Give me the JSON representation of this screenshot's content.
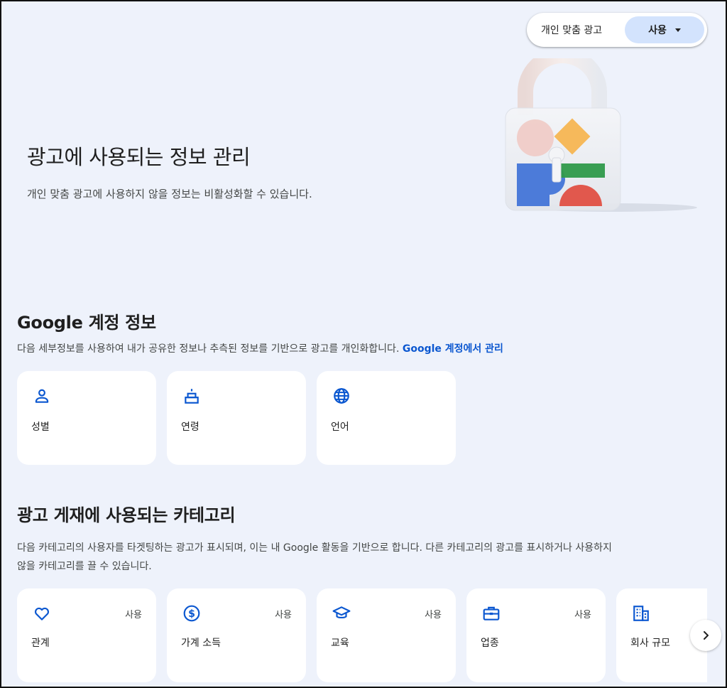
{
  "ad_personalization": {
    "label": "개인 맞춤 광고",
    "value": "사용"
  },
  "hero": {
    "title": "광고에 사용되는 정보 관리",
    "subtitle": "개인 맞춤 광고에 사용하지 않을 정보는 비활성화할 수 있습니다."
  },
  "account_section": {
    "title": "Google 계정 정보",
    "description": "다음 세부정보를 사용하여 내가 공유한 정보나 추측된 정보를 기반으로 광고를 개인화합니다.",
    "link": "Google 계정에서 관리",
    "cards": [
      {
        "label": "성별",
        "icon": "person-icon"
      },
      {
        "label": "연령",
        "icon": "cake-icon"
      },
      {
        "label": "언어",
        "icon": "globe-icon"
      }
    ]
  },
  "categories_section": {
    "title": "광고 게재에 사용되는 카테고리",
    "description_line1": "다음 카테고리의 사용자를 타겟팅하는 광고가 표시되며, 이는 내 Google 활동을 기반으로 합니다. 다른 카테고리의 광고를 표시하거나 사용하지",
    "description_line2": "않을 카테고리를 끌 수 있습니다.",
    "cards": [
      {
        "label": "관계",
        "status": "사용",
        "icon": "heart-icon"
      },
      {
        "label": "가계 소득",
        "status": "사용",
        "icon": "dollar-icon"
      },
      {
        "label": "교육",
        "status": "사용",
        "icon": "graduation-cap-icon"
      },
      {
        "label": "업종",
        "status": "사용",
        "icon": "briefcase-icon"
      },
      {
        "label": "회사 규모",
        "status": "",
        "icon": "building-icon"
      }
    ]
  },
  "colors": {
    "accent": "#0b57d0",
    "toggle_bg": "#d3e3fd",
    "page_bg": "#eef2fb"
  }
}
